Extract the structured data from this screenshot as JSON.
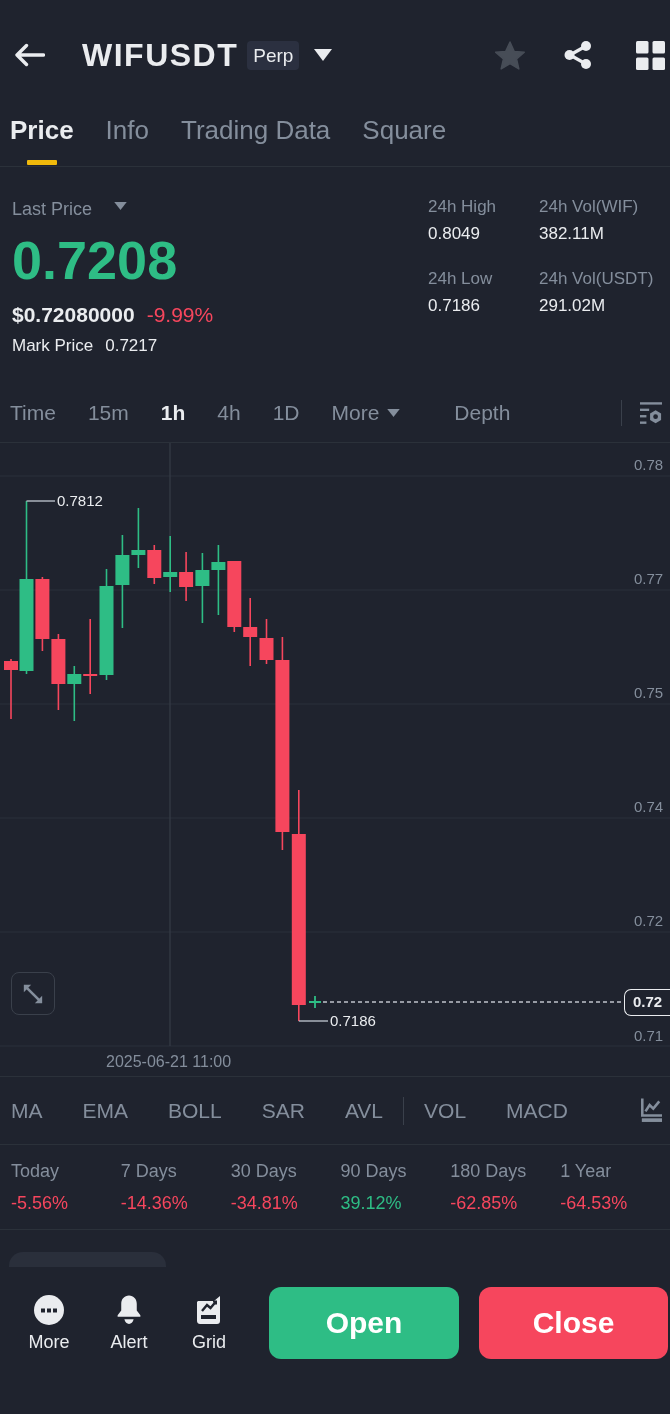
{
  "header": {
    "title": "WIFUSDT",
    "badge": "Perp",
    "favorite": false
  },
  "tabs": [
    {
      "label": "Price",
      "selected": true
    },
    {
      "label": "Info",
      "selected": false
    },
    {
      "label": "Trading Data",
      "selected": false
    },
    {
      "label": "Square",
      "selected": false
    }
  ],
  "ticker": {
    "last_price_label": "Last Price",
    "last_price": "0.7208",
    "last_price_rising": true,
    "usd_price": "$0.72080000",
    "change": "-9.99%",
    "change_negative": true,
    "mark_price_label": "Mark Price",
    "mark_price": "0.7217"
  },
  "stats": [
    {
      "label": "24h High",
      "value": "0.8049"
    },
    {
      "label": "24h Vol(WIF)",
      "value": "382.11M"
    },
    {
      "label": "24h Low",
      "value": "0.7186"
    },
    {
      "label": "24h Vol(USDT)",
      "value": "291.02M"
    }
  ],
  "intervals": [
    {
      "label": "Time",
      "kind": "interval",
      "selected": false
    },
    {
      "label": "15m",
      "kind": "interval",
      "selected": false
    },
    {
      "label": "1h",
      "kind": "interval",
      "selected": true
    },
    {
      "label": "4h",
      "kind": "interval",
      "selected": false
    },
    {
      "label": "1D",
      "kind": "interval",
      "selected": false
    },
    {
      "label": "More",
      "kind": "dropdown",
      "selected": false
    },
    {
      "label": "Depth",
      "kind": "view",
      "selected": false
    }
  ],
  "chart": {
    "y_axis_labels": [
      "0.78",
      "0.77",
      "0.75",
      "0.74",
      "0.72",
      "0.71"
    ],
    "high_label": "0.7812",
    "low_label": "0.7186",
    "current_price": "0.72",
    "crosshair_time": "2025-06-21 11:00"
  },
  "main_indicators": [
    {
      "label": "MA",
      "selected": false
    },
    {
      "label": "EMA",
      "selected": false
    },
    {
      "label": "BOLL",
      "selected": false
    },
    {
      "label": "SAR",
      "selected": false
    },
    {
      "label": "AVL",
      "selected": false
    }
  ],
  "sub_indicators": [
    {
      "label": "VOL",
      "selected": false
    },
    {
      "label": "MACD",
      "selected": false
    }
  ],
  "returns": [
    {
      "period": "Today",
      "value": "-5.56%",
      "negative": true
    },
    {
      "period": "7 Days",
      "value": "-14.36%",
      "negative": true
    },
    {
      "period": "30 Days",
      "value": "-34.81%",
      "negative": true
    },
    {
      "period": "90 Days",
      "value": "39.12%",
      "negative": false
    },
    {
      "period": "180 Days",
      "value": "-62.85%",
      "negative": true
    },
    {
      "period": "1 Year",
      "value": "-64.53%",
      "negative": true
    }
  ],
  "actions": [
    {
      "label": "More",
      "kind": "more"
    },
    {
      "label": "Alert",
      "kind": "alert"
    },
    {
      "label": "Grid",
      "kind": "grid"
    }
  ],
  "buttons": [
    {
      "label": "Open",
      "kind": "open"
    },
    {
      "label": "Close",
      "kind": "close"
    }
  ]
}
